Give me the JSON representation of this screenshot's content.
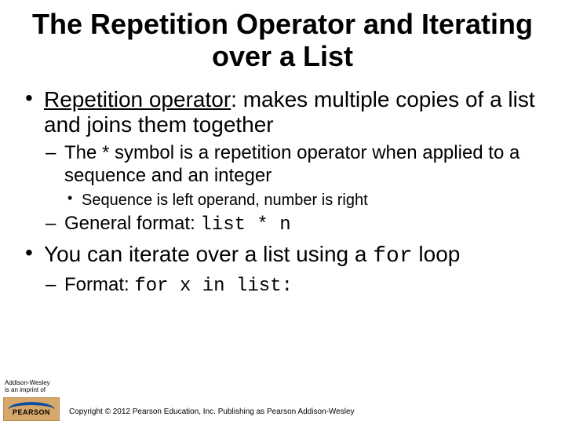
{
  "title": "The Repetition Operator and Iterating over a List",
  "bullets": {
    "b1": {
      "term": "Repetition operator",
      "rest": ": makes multiple copies of a list and joins them together",
      "sub": {
        "s1": "The * symbol is a repetition operator when applied to a sequence and an integer",
        "s1sub": "Sequence is left operand, number is right",
        "s2_lead": "General format: ",
        "s2_code": "list * n"
      }
    },
    "b2": {
      "lead": "You can iterate over a list using a ",
      "code": "for",
      "tail": " loop",
      "sub": {
        "s1_lead": "Format: ",
        "s1_code": "for x in list:"
      }
    }
  },
  "footer": {
    "imprint_line1": "Addison-Wesley",
    "imprint_line2": "is an imprint of",
    "logo_text": "PEARSON",
    "copyright": "Copyright © 2012 Pearson Education, Inc. Publishing as Pearson Addison-Wesley"
  }
}
